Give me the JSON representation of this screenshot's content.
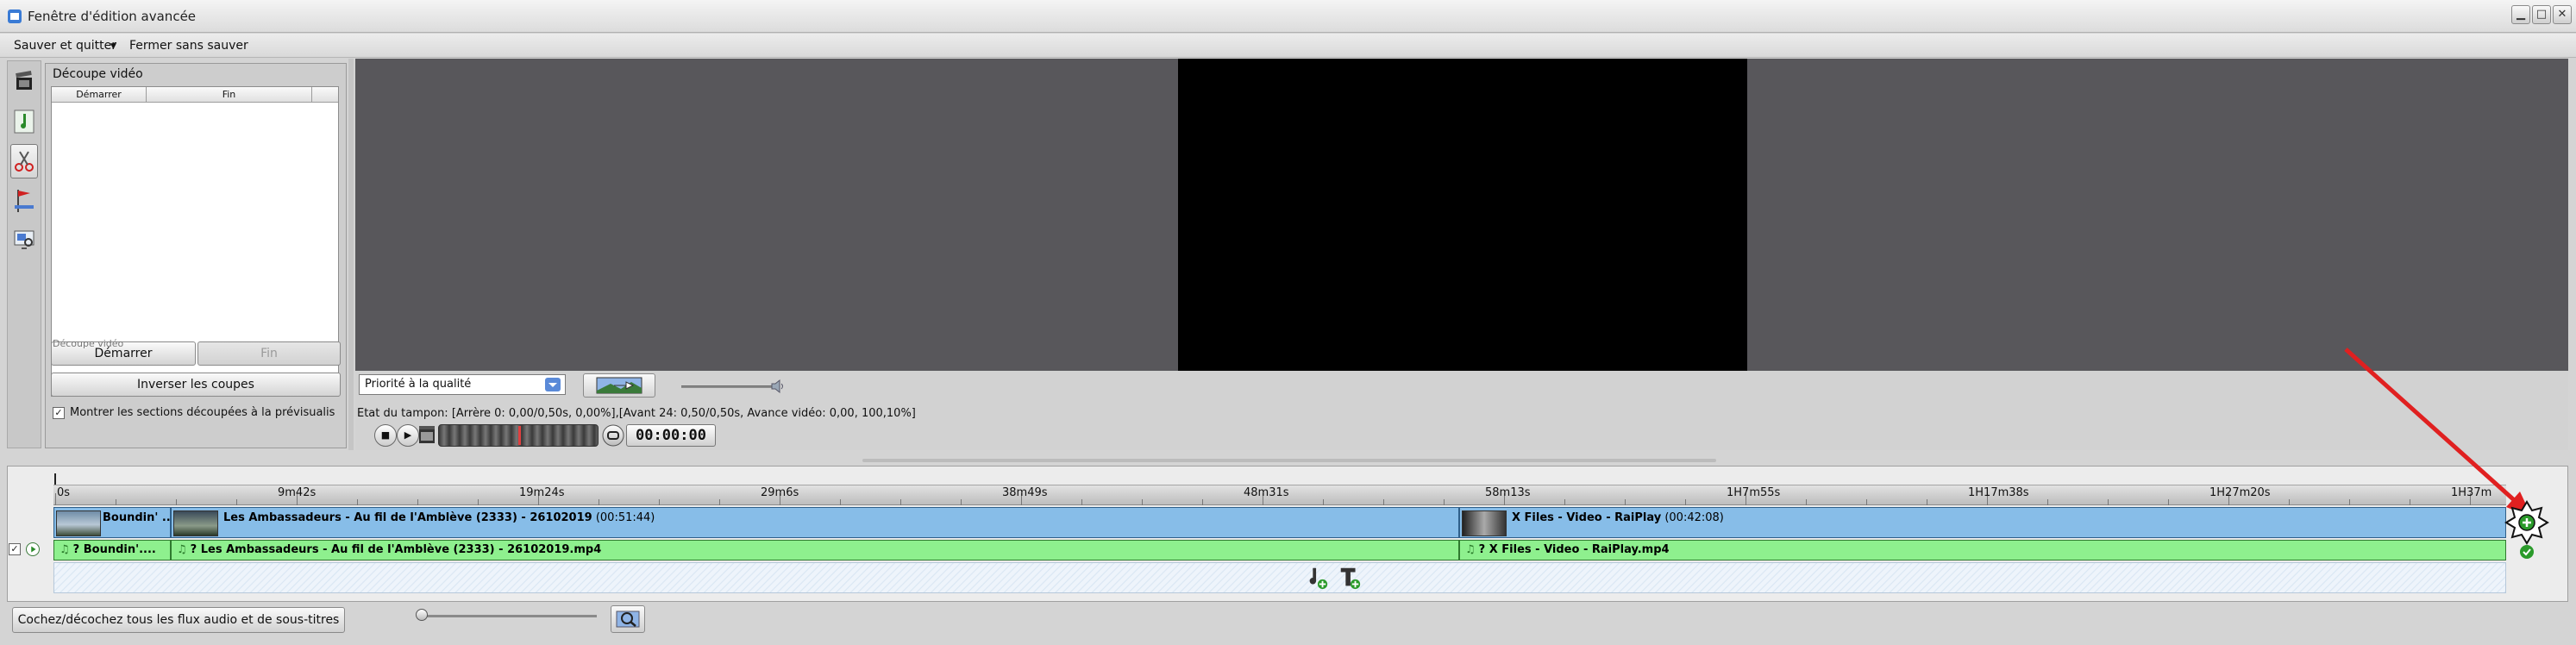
{
  "window": {
    "title": "Fenêtre d'édition avancée",
    "controls": {
      "minimize": "▁",
      "maximize": "□",
      "close": "✕"
    }
  },
  "menu": {
    "save_quit": "Sauver et quitter",
    "save_quit_arrow": "▼",
    "close_no_save": "Fermer sans sauver"
  },
  "cut_panel": {
    "legend": "Découpe vidéo",
    "col_start": "Démarrer",
    "col_end": "Fin",
    "start_button": "Démarrer",
    "start_button_ghost": "Découpe vidéo",
    "end_button": "Fin",
    "invert_button": "Inverser les coupes",
    "show_cut_checkbox_checked": true,
    "show_cut_label": "Montrer les sections découpées à la prévisualis"
  },
  "player": {
    "quality_value": "Priorité à la qualité",
    "buffer_status": "Etat du tampon: [Arrère 0: 0,00/0,50s, 0,00%],[Avant  24: 0,50/0,50s, Avance vidéo: 0,00, 100,10%]",
    "timecode": "00:00:00",
    "stop": "■",
    "play": "▶",
    "volume_fraction": 0.9
  },
  "timeline": {
    "ruler": [
      "0s",
      "9m42s",
      "19m24s",
      "29m6s",
      "38m49s",
      "48m31s",
      "58m13s",
      "1H7m55s",
      "1H17m38s",
      "1H27m20s",
      "1H37m"
    ],
    "video_clips": [
      {
        "title": "Boundin' ...",
        "duration": ""
      },
      {
        "title": "Les Ambassadeurs - Au fil de l'Amblève (2333) - 26102019",
        "duration": "(00:51:44)"
      },
      {
        "title": "X Files - Video - RaiPlay",
        "duration": "(00:42:08)"
      }
    ],
    "audio_clips": [
      {
        "label": "Boundin'...."
      },
      {
        "label": "Les Ambassadeurs - Au fil de l'Amblève (2333) - 26102019.mp4"
      },
      {
        "label": "X Files - Video - RaiPlay.mp4"
      }
    ],
    "audio_marker": "?",
    "track_checked": true,
    "check_mark": "✓"
  },
  "bottom": {
    "all_streams_button": "Cochez/décochez tous les flux audio et de sous-titres"
  },
  "colors": {
    "video_clip": "#87bde8",
    "audio_clip": "#8ef08e",
    "preview_bg": "#58575b",
    "annotation_arrow": "#e02020"
  }
}
